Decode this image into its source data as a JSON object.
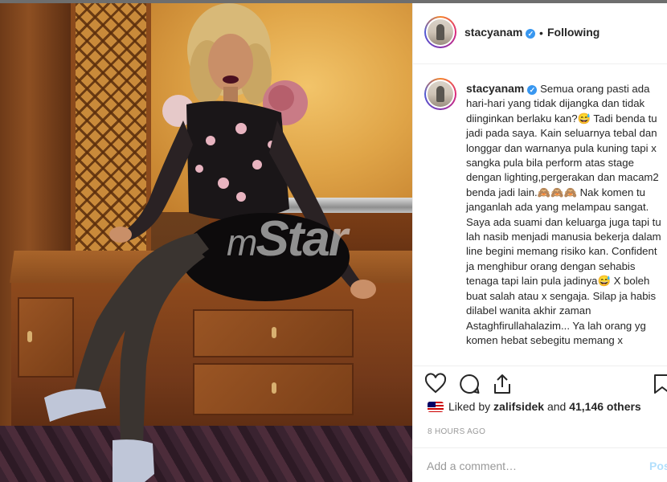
{
  "post": {
    "author": "stacyanam",
    "dot": "•",
    "follow_status": "Following",
    "verified_mark": "✓",
    "caption": "Semua orang pasti ada hari-hari yang tidak dijangka dan tidak diinginkan berlaku kan?😅 Tadi benda tu jadi pada saya. Kain seluarnya tebal dan longgar dan warnanya pula kuning tapi x sangka pula bila perform atas stage dengan lighting,pergerakan dan macam2 benda jadi lain.🙈🙈🙈 Nak komen tu janganlah ada yang melampau sangat. Saya ada suami dan keluarga juga tapi tu lah nasib menjadi manusia bekerja dalam line begini memang risiko kan. Confident ja menghibur orang dengan sehabis tenaga tapi lain pula jadinya😅 X boleh buat salah atau x sengaja. Silap ja habis dilabel wanita akhir zaman Astaghfirullahalazim... Ya lah orang yg komen hebat sebegitu memang x",
    "likes_prefix": "Liked by",
    "liked_by": "zalifsidek",
    "likes_and": "and",
    "likes_count": "41,146 others",
    "timestamp": "8 HOURS AGO",
    "comment_placeholder": "Add a comment…",
    "post_label": "Pos"
  },
  "photo": {
    "watermark_prefix": "m",
    "watermark_text": "Star"
  },
  "icons": {
    "like": "heart-icon",
    "comment": "comment-icon",
    "share": "share-icon",
    "save": "bookmark-icon"
  },
  "colors": {
    "link_blue": "#3897f0",
    "post_disabled": "#b2dffc",
    "muted": "#999999",
    "text": "#262626"
  }
}
